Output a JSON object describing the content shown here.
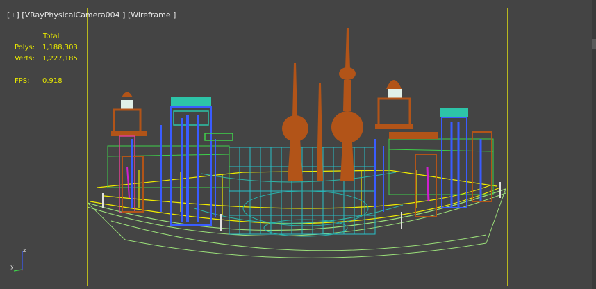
{
  "viewport": {
    "label": "[+] [VRayPhysicalCamera004 ] [Wireframe ]",
    "stats": {
      "header": "Total",
      "polys_label": "Polys:",
      "polys_value": "1,188,303",
      "verts_label": "Verts:",
      "verts_value": "1,227,185",
      "fps_label": "FPS:",
      "fps_value": "0.918"
    },
    "axis": {
      "z": "z",
      "y": "y",
      "x": "x"
    }
  },
  "colors": {
    "background": "#444444",
    "safe_frame": "#b8b81e",
    "stats_text": "#e8e800",
    "label_text": "#e6e6e6"
  }
}
